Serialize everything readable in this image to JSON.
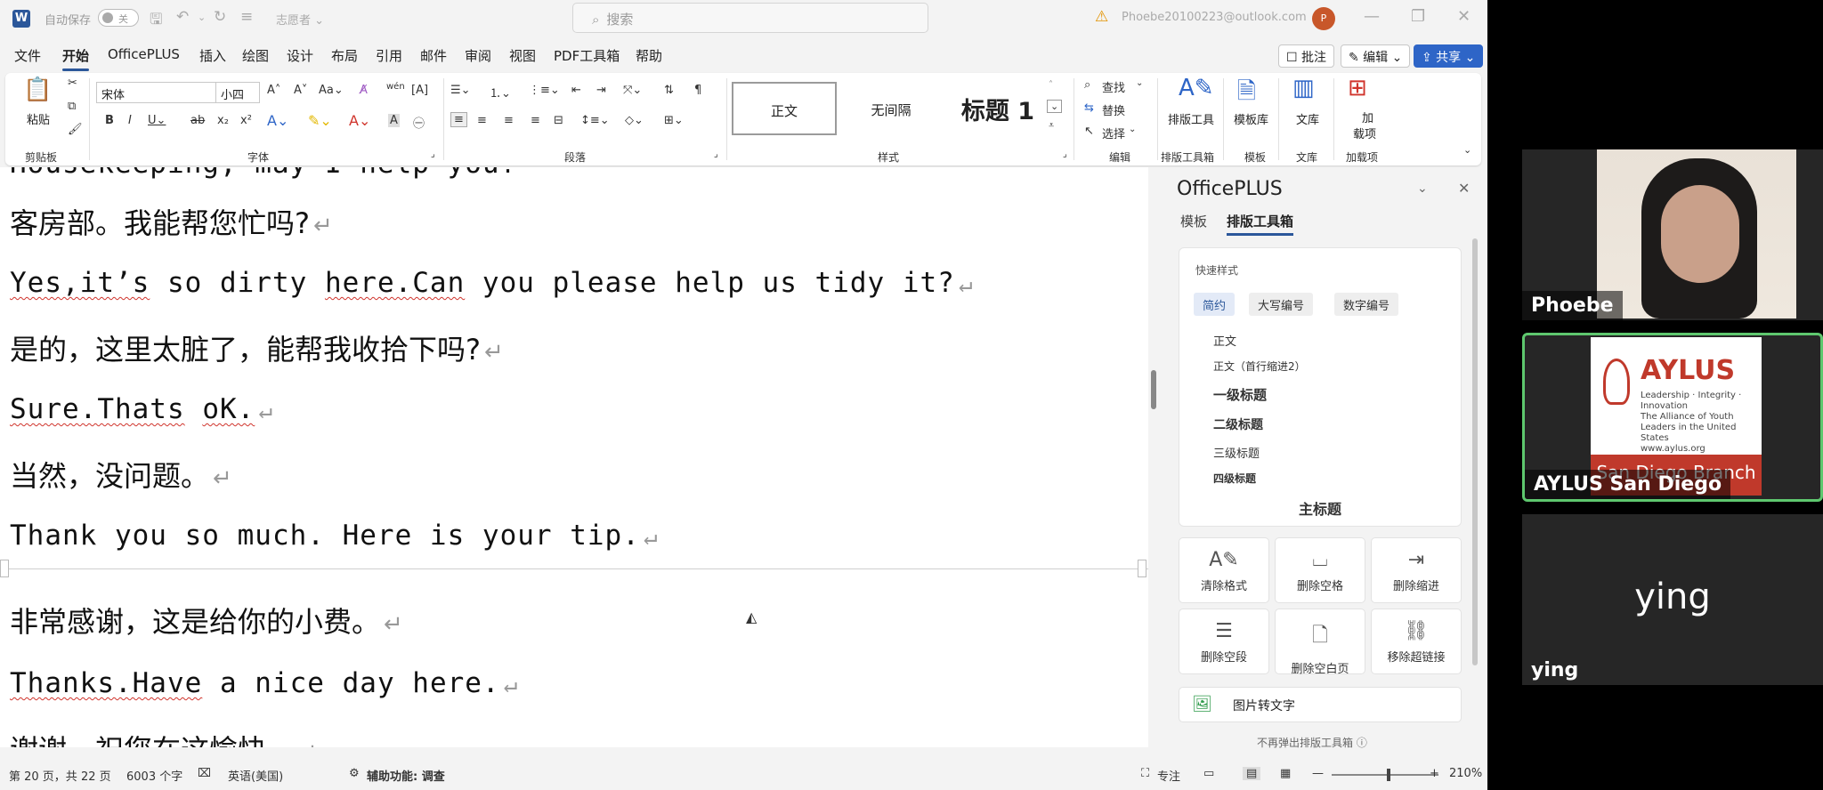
{
  "titlebar": {
    "app_logo": "W",
    "autosave_label": "自动保存",
    "autosave_state": "关",
    "doc_name": "志愿者 ⌄",
    "search_placeholder": "搜索",
    "account": "Phoebe20100223@outlook.com",
    "avatar_initial": "P"
  },
  "menubar": {
    "items": [
      "文件",
      "开始",
      "OfficePLUS",
      "插入",
      "绘图",
      "设计",
      "布局",
      "引用",
      "邮件",
      "审阅",
      "视图",
      "PDF工具箱",
      "帮助"
    ],
    "active": "开始",
    "comment_btn": "☐ 批注",
    "edit_btn": "✎ 编辑 ⌄",
    "share_btn": "⇪ 共享 ⌄"
  },
  "ribbon": {
    "clipboard": {
      "paste": "粘贴",
      "label": "剪贴板"
    },
    "font": {
      "name": "宋体",
      "size": "小四",
      "label": "字体"
    },
    "paragraph": {
      "label": "段落"
    },
    "styles": {
      "normal": "正文",
      "no_spacing": "无间隔",
      "heading1": "标题 1",
      "label": "样式"
    },
    "editing": {
      "find": "查找",
      "replace": "替换",
      "select": "选择",
      "label": "编辑"
    },
    "layout_tools": {
      "btn": "排版工具",
      "label": "排版工具箱"
    },
    "templates": {
      "btn": "模板库",
      "label": "模板"
    },
    "library": {
      "btn": "文库",
      "label": "文库"
    },
    "addins": {
      "btn1": "加",
      "btn2": "载项",
      "label": "加载项"
    }
  },
  "document": {
    "partial_top": "Housekeeping, may I help you?",
    "lines": [
      {
        "text": "客房部。我能帮您忙吗?",
        "lang": "zh"
      },
      {
        "pre": "",
        "sq1": "Yes,it’s",
        "mid": " so dirty ",
        "sq2": "here.Can",
        "post": " you please help us tidy it?",
        "lang": "en"
      },
      {
        "text": "是的，这里太脏了，能帮我收拾下吗?",
        "lang": "zh"
      },
      {
        "sq1": "Sure.Thats",
        "mid": " ",
        "sq2": "oK.",
        "post": "",
        "lang": "en"
      },
      {
        "text": "当然，没问题。",
        "lang": "zh"
      },
      {
        "text": "Thank you so much. Here is your tip.",
        "lang": "en"
      },
      {
        "text": "非常感谢，这是给你的小费。",
        "lang": "zh"
      },
      {
        "sq1": "Thanks.Have",
        "post": " a nice day here.",
        "lang": "en"
      },
      {
        "text": "谢谢，祝您在这愉快。",
        "lang": "zh"
      }
    ],
    "para_mark": "↵"
  },
  "panel": {
    "title": "OfficePLUS",
    "tabs": [
      "模板",
      "排版工具箱"
    ],
    "quick_styles_label": "快速样式",
    "chips": [
      "简约",
      "大写编号",
      "数字编号"
    ],
    "style_items": [
      "正文",
      "正文（首行缩进2）",
      "一级标题",
      "二级标题",
      "三级标题",
      "四级标题",
      "主标题"
    ],
    "tools": [
      "清除格式",
      "删除空格",
      "删除缩进",
      "删除空段",
      "删除空白页",
      "移除超链接"
    ],
    "img2text": "图片转文字",
    "footer": "不再弹出排版工具箱 ⓘ"
  },
  "statusbar": {
    "page": "第 20 页，共 22 页",
    "words": "6003 个字",
    "lang": "英语(美国)",
    "accessibility": "辅助功能: 调查",
    "focus": "专注",
    "zoom": "210%"
  },
  "video": {
    "tiles": [
      {
        "name": "Phoebe"
      },
      {
        "name": "AYLUS San Diego",
        "logo_word": "AYLUS",
        "logo_sub": "Leadership · Integrity · Innovation\nThe Alliance of Youth Leaders in the United States\nwww.aylus.org",
        "logo_banner": "San Diego Branch"
      },
      {
        "name": "ying",
        "big_name": "ying"
      }
    ]
  },
  "colors": {
    "word_blue": "#2b579a",
    "share_blue": "#2e65c7",
    "aylus_red": "#c0392b",
    "speaker_green": "#5ec76e"
  }
}
